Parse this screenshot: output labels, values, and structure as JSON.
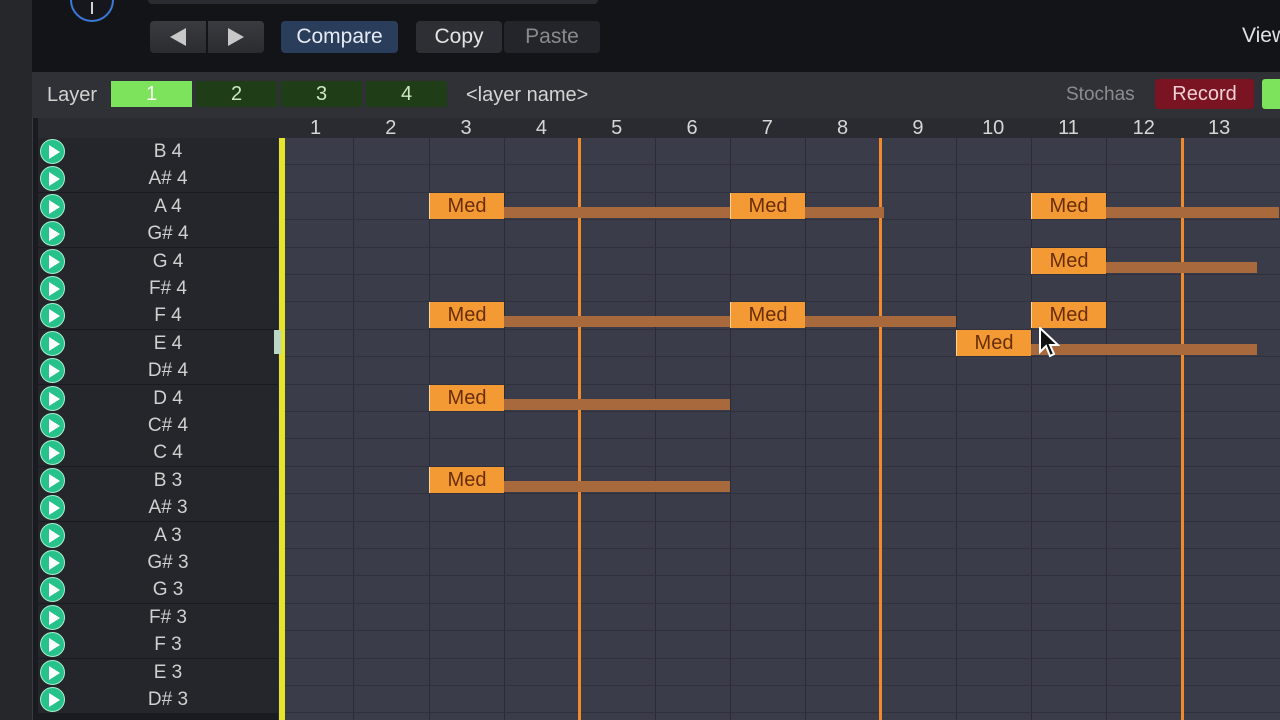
{
  "toolbar": {
    "prev_label": "",
    "next_label": "",
    "compare_label": "Compare",
    "copy_label": "Copy",
    "paste_label": "Paste",
    "view_label": "View"
  },
  "layers": {
    "label": "Layer",
    "tabs": [
      "1",
      "2",
      "3",
      "4"
    ],
    "active": "1",
    "name": "<layer name>"
  },
  "right_controls": {
    "stochas_label": "Stochas",
    "record_label": "Record"
  },
  "colors": {
    "active_tab": "#7de35c",
    "inactive_tab": "#1f3d16",
    "record": "#7a1422",
    "note": "#f39a35",
    "bar_line": "#f08a2a",
    "playhead": "#e8e42c"
  },
  "grid": {
    "columns": [
      "1",
      "2",
      "3",
      "4",
      "5",
      "6",
      "7",
      "8",
      "9",
      "10",
      "11",
      "12",
      "13"
    ],
    "rows": [
      "B 4",
      "A# 4",
      "A 4",
      "G# 4",
      "G 4",
      "F# 4",
      "F 4",
      "E 4",
      "D# 4",
      "D 4",
      "C# 4",
      "C 4",
      "B 3",
      "A# 3",
      "A 3",
      "G# 3",
      "G 3",
      "F# 3",
      "F 3",
      "E 3",
      "D# 3"
    ],
    "notes": [
      {
        "row": 2,
        "col": 3,
        "label": "Med",
        "length": 4
      },
      {
        "row": 2,
        "col": 7,
        "label": "Med",
        "length": 2.05
      },
      {
        "row": 2,
        "col": 11,
        "label": "Med",
        "length": 3.3
      },
      {
        "row": 4,
        "col": 11,
        "label": "Med",
        "length": 3
      },
      {
        "row": 6,
        "col": 3,
        "label": "Med",
        "length": 4
      },
      {
        "row": 6,
        "col": 7,
        "label": "Med",
        "length": 3
      },
      {
        "row": 6,
        "col": 11,
        "label": "Med",
        "length": 1
      },
      {
        "row": 7,
        "col": 10,
        "label": "Med",
        "length": 4
      },
      {
        "row": 9,
        "col": 3,
        "label": "Med",
        "length": 4
      },
      {
        "row": 12,
        "col": 3,
        "label": "Med",
        "length": 4
      }
    ]
  }
}
